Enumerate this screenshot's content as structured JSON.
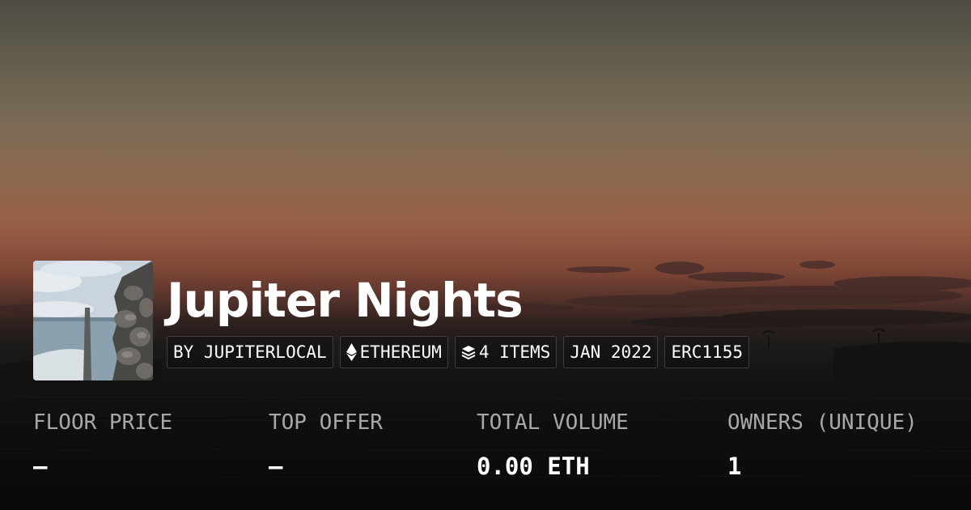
{
  "collection": {
    "title": "Jupiter Nights",
    "thumbnail_icon": "seascape-thumbnail"
  },
  "tags": {
    "creator": "BY JUPITERLOCAL",
    "chain": "ETHEREUM",
    "chain_icon": "ethereum-icon",
    "items": "4 ITEMS",
    "items_icon": "layers-icon",
    "date": "JAN 2022",
    "standard": "ERC1155"
  },
  "stats": {
    "floor_price": {
      "label": "FLOOR PRICE",
      "value": "—"
    },
    "top_offer": {
      "label": "TOP OFFER",
      "value": "—"
    },
    "total_volume": {
      "label": "TOTAL VOLUME",
      "value": "0.00 ETH"
    },
    "owners": {
      "label": "OWNERS (UNIQUE)",
      "value": "1"
    }
  },
  "colors": {
    "sky_top": "#4e4c46",
    "sunset_orange": "#8f624a",
    "label_gray": "#a8a8a8",
    "text_white": "#ffffff"
  }
}
